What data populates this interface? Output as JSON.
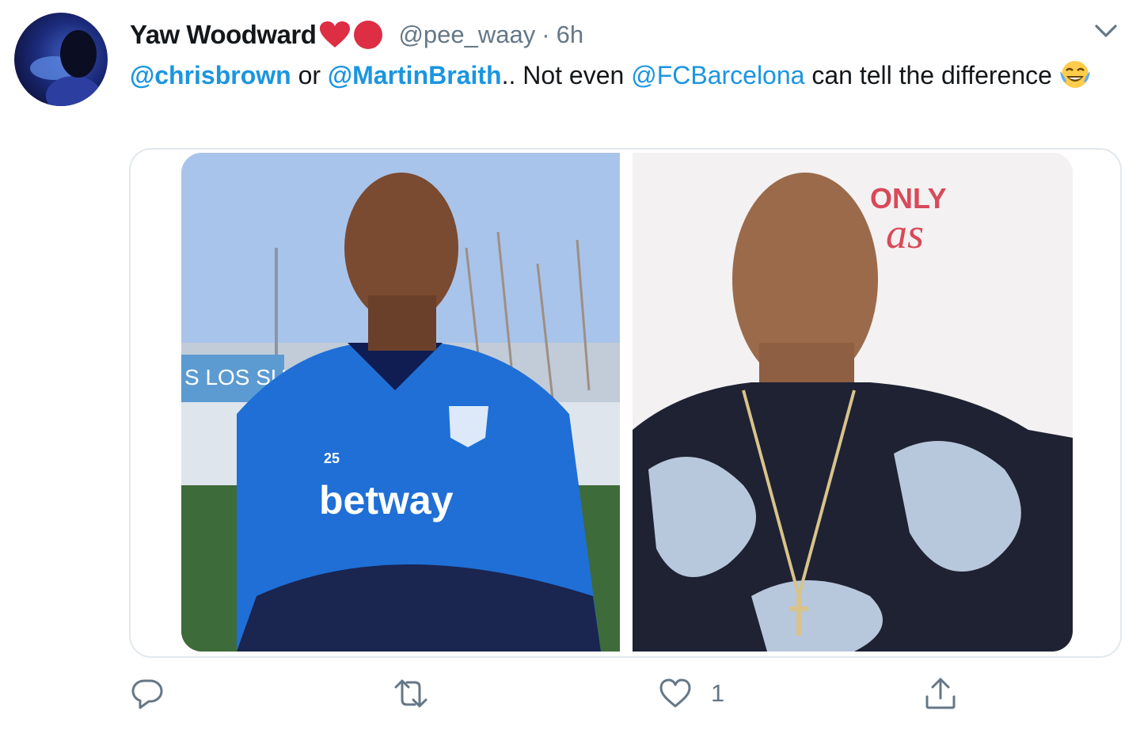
{
  "tweet": {
    "display_name": "Yaw Woodward",
    "handle": "@pee_waay",
    "separator": "·",
    "time": "6h",
    "text": {
      "mention1": "@chrisbrown",
      "or": " or ",
      "mention2": "@MartinBraith",
      "part2": ".. Not even ",
      "mention3": "@FCBarcelona",
      "part3": " can tell the difference"
    },
    "photos": {
      "left": {
        "jersey_number": "25",
        "sponsor": "betway",
        "banner": "S LOS SUEÑ"
      },
      "right": {
        "sign_top": "ONLY",
        "sign_bottom": "as"
      }
    }
  },
  "actions": {
    "likes": "1"
  },
  "colors": {
    "link": "#1b95e0",
    "muted": "#657786",
    "heart": "#dd2e44",
    "text": "#14171a",
    "border": "#e1e8ed"
  },
  "icons": [
    "chevron-down-icon",
    "red-heart-emoji-icon",
    "red-circle-emoji-icon",
    "tears-of-joy-emoji-icon",
    "reply-icon",
    "retweet-icon",
    "like-icon",
    "share-icon"
  ]
}
